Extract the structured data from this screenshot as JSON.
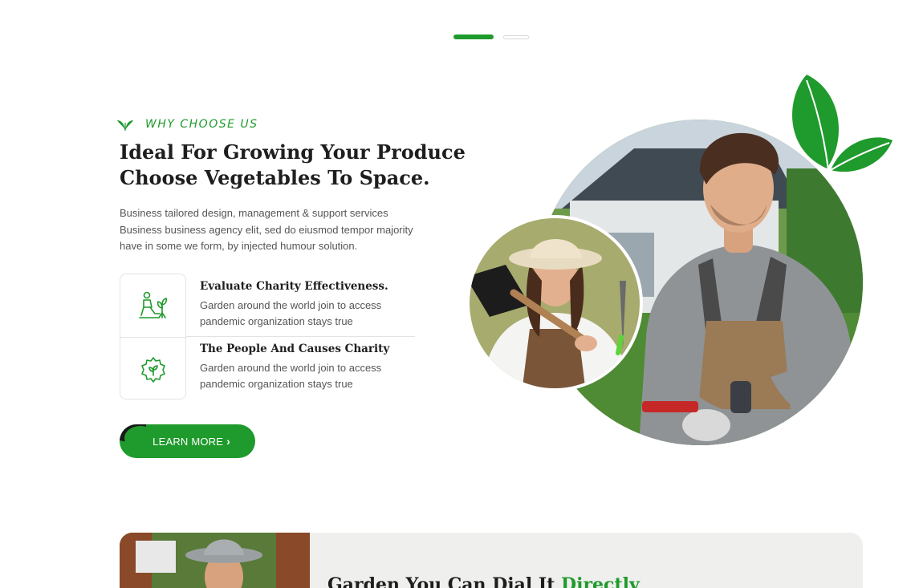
{
  "slider": {
    "dots": [
      {
        "state": "active"
      },
      {
        "state": "inactive"
      }
    ]
  },
  "section": {
    "eyebrow": "WHY CHOOSE US",
    "heading_line1": "Ideal For Growing Your Produce",
    "heading_line2": "Choose Vegetables To Space.",
    "intro": "Business tailored design, management & support services Business business agency elit, sed do eiusmod tempor  majority have in some we form, by injected humour solution."
  },
  "features": [
    {
      "icon": "gardener-icon",
      "title": "Evaluate Charity Effectiveness.",
      "description": "Garden around the world join to access pandemic organization stays true"
    },
    {
      "icon": "flower-gear-icon",
      "title": "The People And Causes Charity",
      "description": "Garden around the world join to access pandemic organization stays true"
    }
  ],
  "cta": {
    "label": "LEARN MORE",
    "arrow": "›"
  },
  "bottom_banner": {
    "title_start": "Garden You Can Dial It ",
    "title_accent": "Directly"
  },
  "colors": {
    "accent": "#1f9a2c",
    "dark": "#1e1e1e",
    "text": "#555555"
  }
}
